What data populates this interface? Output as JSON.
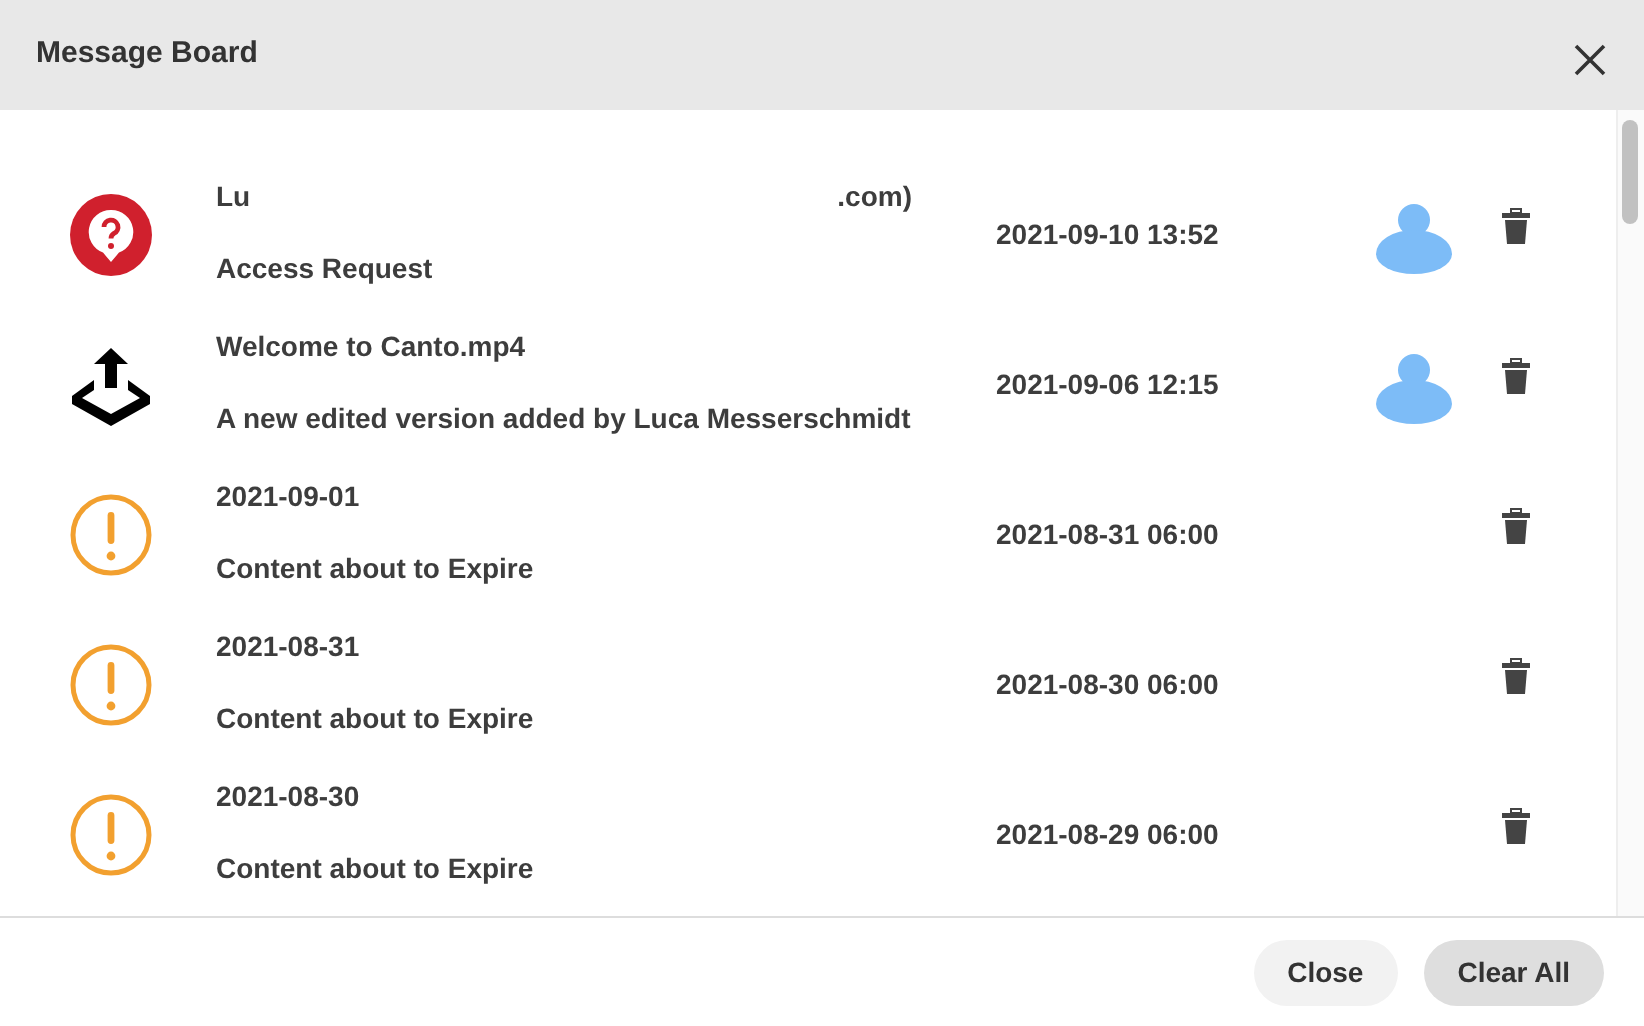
{
  "window": {
    "title": "Message Board"
  },
  "messages": [
    {
      "kind": "request",
      "title_fragments": [
        "Lu",
        ".com)"
      ],
      "subtitle": "Access Request",
      "date": "2021-09-10 13:52",
      "avatar": true
    },
    {
      "kind": "upload",
      "title_fragments": [
        "Welcome to Canto.mp4"
      ],
      "subtitle": "A new edited version added by Luca Messerschmidt",
      "date": "2021-09-06 12:15",
      "avatar": true
    },
    {
      "kind": "warning",
      "title_fragments": [
        "2021-09-01"
      ],
      "subtitle": "Content about to Expire",
      "date": "2021-08-31 06:00",
      "avatar": false
    },
    {
      "kind": "warning",
      "title_fragments": [
        "2021-08-31"
      ],
      "subtitle": "Content about to Expire",
      "date": "2021-08-30 06:00",
      "avatar": false
    },
    {
      "kind": "warning",
      "title_fragments": [
        "2021-08-30"
      ],
      "subtitle": "Content about to Expire",
      "date": "2021-08-29 06:00",
      "avatar": false
    }
  ],
  "buttons": [
    "Close",
    "Clear All"
  ]
}
